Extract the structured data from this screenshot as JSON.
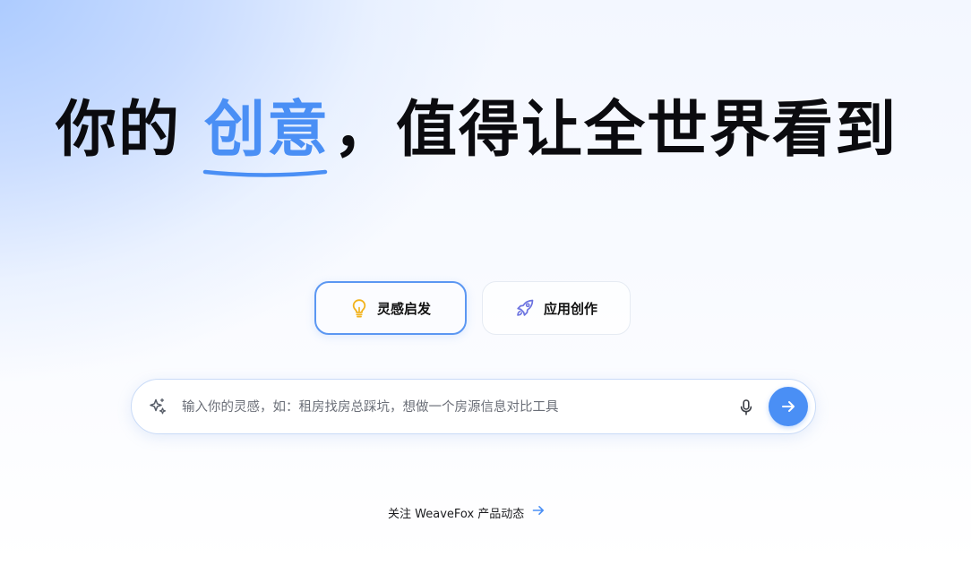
{
  "headline": {
    "prefix": "你的",
    "highlight": "创意",
    "suffix": "，值得让全世界看到"
  },
  "modes": [
    {
      "label": "灵感启发",
      "icon": "lightbulb-icon",
      "active": true
    },
    {
      "label": "应用创作",
      "icon": "rocket-icon",
      "active": false
    }
  ],
  "search": {
    "placeholder": "输入你的灵感，如：租房找房总踩坑，想做一个房源信息对比工具",
    "value": ""
  },
  "follow": {
    "label": "关注 WeaveFox 产品动态"
  },
  "colors": {
    "accent": "#4a8ff5",
    "lightbulb": "#f2b21b",
    "rocket": "#6b72e0"
  }
}
